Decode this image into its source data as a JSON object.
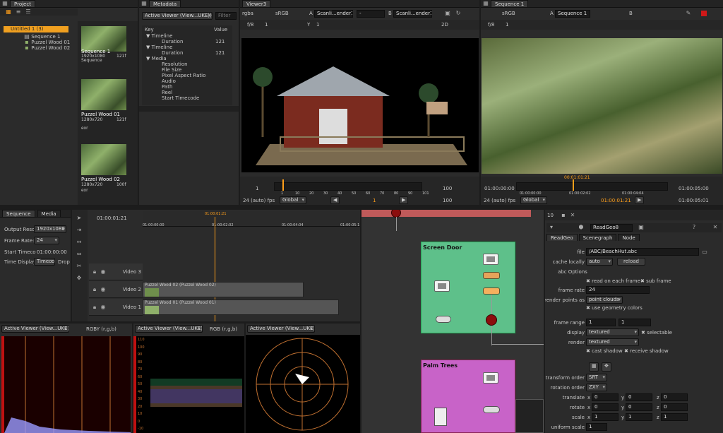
{
  "project": {
    "tab": "Project",
    "root": "Untitled 1 (3)",
    "items": [
      "Sequence 1",
      "Puzzel Wood 01",
      "Puzzel Wood 02"
    ],
    "thumbs": [
      {
        "name": "Sequence 1",
        "res": "1920x1080",
        "type": "Sequence",
        "frames": "121f",
        "fps": "24"
      },
      {
        "name": "Puzzel Wood 01",
        "res": "1280x720",
        "type": "exr",
        "frames": "121f",
        "fps": "6"
      },
      {
        "name": "Puzzel Wood 02",
        "res": "1280x720",
        "type": "exr",
        "frames": "100f",
        "fps": "6"
      }
    ]
  },
  "metadata": {
    "tab": "Metadata",
    "viewer": "Active Viewer (View...UKE))",
    "filter": "Filter",
    "col_key": "Key",
    "col_value": "Value",
    "rows": [
      {
        "k": "Timeline",
        "v": "",
        "lvl": 1,
        "exp": true
      },
      {
        "k": "Duration",
        "v": "121",
        "lvl": 2
      },
      {
        "k": "Timeline",
        "v": "",
        "lvl": 1,
        "exp": true
      },
      {
        "k": "Duration",
        "v": "121",
        "lvl": 2
      },
      {
        "k": "Media",
        "v": "",
        "lvl": 1,
        "exp": true
      },
      {
        "k": "Resolution",
        "v": "",
        "lvl": 2
      },
      {
        "k": "File Size",
        "v": "",
        "lvl": 2
      },
      {
        "k": "Pixel Aspect Ratio",
        "v": "",
        "lvl": 2
      },
      {
        "k": "Audio",
        "v": "",
        "lvl": 2
      },
      {
        "k": "Path",
        "v": "",
        "lvl": 2
      },
      {
        "k": "Reel",
        "v": "",
        "lvl": 2
      },
      {
        "k": "Start Timecode",
        "v": "",
        "lvl": 2
      }
    ]
  },
  "viewer3": {
    "tab": "Viewer3",
    "chan": "rgba",
    "cs": "sRGB",
    "a": "A",
    "a_val": "Scanli...ender1",
    "dash": "-",
    "b": "B",
    "b_val": "Scanli...ender1",
    "fstop": "f/8",
    "one": "1",
    "y": "Y",
    "y_val": "1",
    "mode": "2D",
    "tl_start": "1",
    "tl_end": "100",
    "ticks": [
      "1",
      "10",
      "20",
      "30",
      "40",
      "50",
      "60",
      "70",
      "80",
      "90",
      "101"
    ],
    "fps": "24 (auto) fps",
    "global": "Global",
    "frame": "1",
    "end2": "100"
  },
  "seqviewer": {
    "tab": "Sequence 1",
    "cs": "sRGB",
    "a": "A",
    "a_val": "Sequence 1",
    "b": "B",
    "fstop": "f/8",
    "one": "1",
    "tc_cur": "00:01:01:21",
    "tc_start": "01:00:00:00",
    "tc_end": "01:00:05:00",
    "ticks": [
      "01:00:00:00",
      "01:00:02:02",
      "01:00:04:04"
    ],
    "fps": "24 (auto) fps",
    "global": "Global",
    "tc_now": "01:00:01:21",
    "tc_total": "01:00:05:01"
  },
  "sequence": {
    "tab1": "Sequence",
    "tab2": "Media",
    "fields": [
      {
        "l": "Output Reso",
        "v": "1920x1080"
      },
      {
        "l": "Frame Rate:",
        "v": "24"
      },
      {
        "l": "Start Timeco",
        "v": "01:00:00:00"
      },
      {
        "l": "Time Display",
        "v": "Timeco"
      }
    ],
    "drop": "Drop",
    "cur": "01:00:01:21",
    "ruler": [
      "01:00:00:00",
      "01:00:02:02",
      "01:00:04:04",
      "01:00:05:1"
    ],
    "playhead": "01:00:01:21",
    "tracks": [
      {
        "n": "Video 3"
      },
      {
        "n": "Video 2",
        "clip": "Puzzel Wood 02 (Puzzel Wood 02)"
      },
      {
        "n": "Video 1",
        "clip": "Puzzel Wood 01 (Puzzel Wood 01)"
      }
    ]
  },
  "scopes": {
    "viewer": "Active Viewer (View...UKE))",
    "mode1": "RGBY (r,g,b)",
    "mode2": "RGB (r,g,b)",
    "wave_labels": [
      "110",
      "100",
      "90",
      "80",
      "70",
      "60",
      "50",
      "40",
      "30",
      "20",
      "10",
      "0",
      "-10"
    ]
  },
  "nodegraph": {
    "groups": [
      {
        "name": "Screen Door",
        "color": "#5ec08a"
      },
      {
        "name": "Palm Trees",
        "color": "#c863c8"
      }
    ]
  },
  "props": {
    "tabs": [
      "ReadGeo",
      "Scenegraph",
      "Node"
    ],
    "num": "10",
    "node_name": "ReadGeo8",
    "file_label": "file",
    "file": "/ABC/BeachHut.abc",
    "cache_label": "cache locally",
    "cache": "auto",
    "reload": "reload",
    "abc": "abc Options",
    "read_each": "read on each frame",
    "sub": "sub frame",
    "fr_label": "frame rate",
    "fr": "24",
    "rp_label": "render points as",
    "rp": "point clouds",
    "use_geo": "use geometry colors",
    "range_label": "frame range",
    "range1": "1",
    "range2": "1",
    "disp_label": "display",
    "disp": "textured",
    "selectable": "selectable",
    "render_label": "render",
    "render": "textured",
    "cast": "cast shadow",
    "recv": "receive shadow",
    "to_label": "transform order",
    "to": "SRT",
    "ro_label": "rotation order",
    "ro": "ZXY",
    "translate": "translate",
    "rotate": "rotate",
    "scale": "scale",
    "uniform": "uniform scale",
    "x": "x",
    "y": "y",
    "z": "z",
    "t": [
      "0",
      "0",
      "0"
    ],
    "r": [
      "0",
      "0",
      "0"
    ],
    "s": [
      "1",
      "1",
      "1"
    ],
    "u": "1"
  },
  "colors": {
    "accent": "#ff9f1a",
    "selection": "#f0a020"
  }
}
